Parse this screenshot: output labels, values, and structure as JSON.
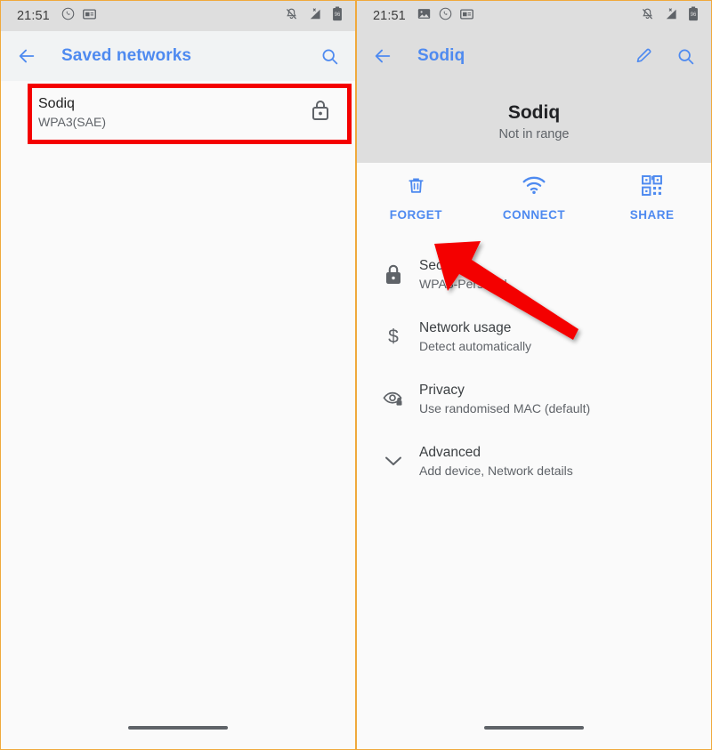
{
  "colors": {
    "accent_blue": "#4e8af0",
    "annotation_red": "#f40000",
    "divider_orange": "#f0a93c",
    "status_bar_gray": "#dedede",
    "body_bg": "#fafafa",
    "primary_text": "#212121",
    "secondary_text": "#5f6368"
  },
  "left_panel": {
    "status_bar": {
      "time": "21:51",
      "left_icons": [
        "whatsapp-icon",
        "note-icon"
      ],
      "right_icons": [
        "notifications-off-icon",
        "signal-no-sim-icon",
        "battery-96-icon"
      ]
    },
    "app_bar": {
      "back_icon": "back-arrow-icon",
      "title": "Saved networks",
      "search_icon": "search-icon"
    },
    "network_list": [
      {
        "name": "Sodiq",
        "security": "WPA3(SAE)",
        "lock_icon": "lock-icon",
        "highlighted": true
      }
    ]
  },
  "right_panel": {
    "status_bar": {
      "time": "21:51",
      "left_icons": [
        "image-icon",
        "whatsapp-icon",
        "note-icon"
      ],
      "right_icons": [
        "notifications-off-icon",
        "signal-no-sim-icon",
        "battery-96-icon"
      ]
    },
    "app_bar": {
      "back_icon": "back-arrow-icon",
      "title": "Sodiq",
      "edit_icon": "pencil-edit-icon",
      "search_icon": "search-icon"
    },
    "hero": {
      "title": "Sodiq",
      "status": "Not in range"
    },
    "actions": [
      {
        "label": "FORGET",
        "icon": "trash-icon"
      },
      {
        "label": "CONNECT",
        "icon": "wifi-icon"
      },
      {
        "label": "SHARE",
        "icon": "qr-code-icon"
      }
    ],
    "settings": [
      {
        "icon": "lock-icon",
        "title": "Security",
        "subtitle": "WPA3-Personal"
      },
      {
        "icon": "dollar-icon",
        "title": "Network usage",
        "subtitle": "Detect automatically"
      },
      {
        "icon": "eye-lock-icon",
        "title": "Privacy",
        "subtitle": "Use randomised MAC (default)"
      },
      {
        "icon": "chevron-down-icon",
        "title": "Advanced",
        "subtitle": "Add device, Network details"
      }
    ]
  },
  "annotations": {
    "highlight_box_target": "Sodiq saved network row",
    "arrow_target": "FORGET button"
  }
}
